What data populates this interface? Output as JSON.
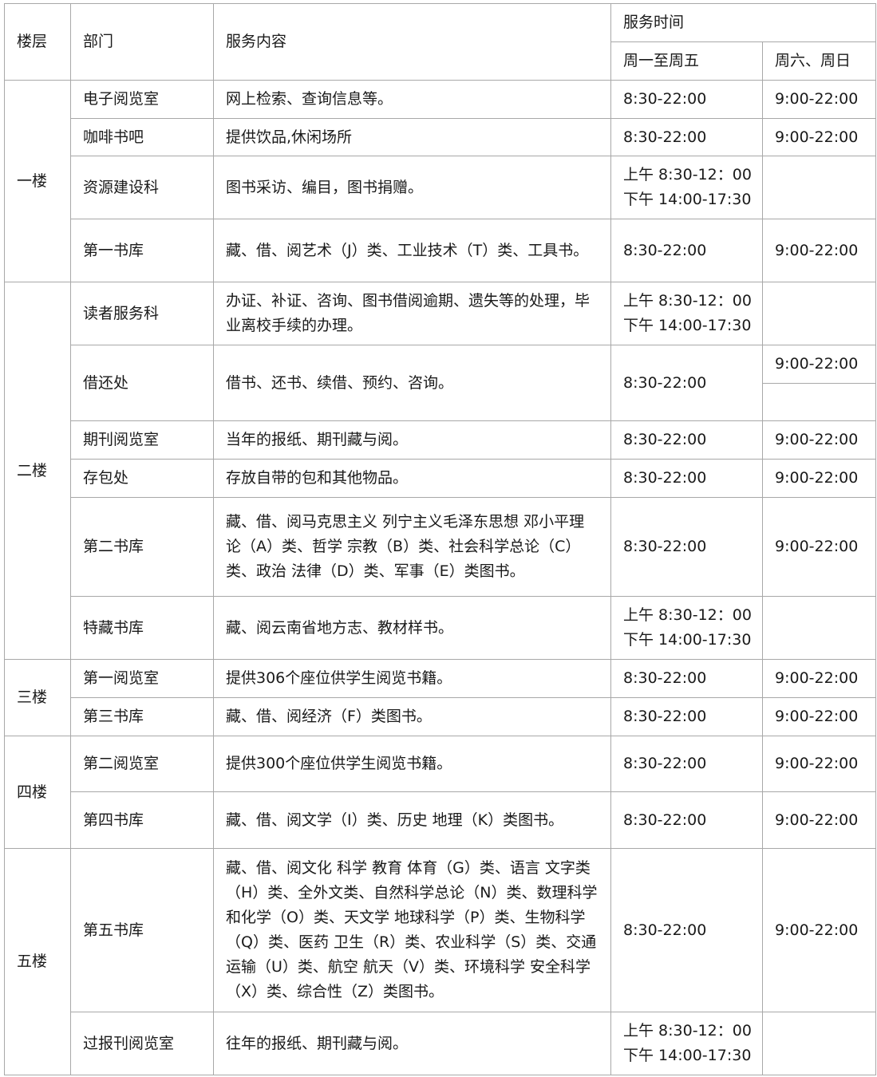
{
  "headers": {
    "floor": "楼层",
    "dept": "部门",
    "content": "服务内容",
    "service_time": "服务时间",
    "weekday": "周一至周五",
    "weekend": "周六、周日"
  },
  "floors": [
    "一楼",
    "二楼",
    "三楼",
    "四楼",
    "五楼"
  ],
  "rows": [
    {
      "dept": "电子阅览室",
      "content": "网上检索、查询信息等。",
      "weekday": "8:30-22:00",
      "weekend": "9:00-22:00"
    },
    {
      "dept": "咖啡书吧",
      "content": "提供饮品,休闲场所",
      "weekday": "8:30-22:00",
      "weekend": "9:00-22:00"
    },
    {
      "dept": "资源建设科",
      "content": "图书采访、编目，图书捐赠。",
      "weekday_am": "上午 8:30-12：00",
      "weekday_pm": "下午 14:00-17:30",
      "weekend": ""
    },
    {
      "dept": "第一书库",
      "content": "藏、借、阅艺术（J）类、工业技术（T）类、工具书。",
      "weekday": "8:30-22:00",
      "weekend": "9:00-22:00"
    },
    {
      "dept": "读者服务科",
      "content": "办证、补证、咨询、图书借阅逾期、遗失等的处理，毕业离校手续的办理。",
      "weekday_am": "上午 8:30-12：00",
      "weekday_pm": "下午 14:00-17:30",
      "weekend": ""
    },
    {
      "dept": "借还处",
      "content": "借书、还书、续借、预约、咨询。",
      "weekday": "8:30-22:00",
      "weekend": "9:00-22:00",
      "weekend_extra": ""
    },
    {
      "dept": "期刊阅览室",
      "content": "当年的报纸、期刊藏与阅。",
      "weekday": "8:30-22:00",
      "weekend": "9:00-22:00"
    },
    {
      "dept": "存包处",
      "content": "存放自带的包和其他物品。",
      "weekday": "8:30-22:00",
      "weekend": "9:00-22:00"
    },
    {
      "dept": "第二书库",
      "content": "藏、借、阅马克思主义 列宁主义毛泽东思想 邓小平理论（A）类、哲学 宗教（B）类、社会科学总论（C）类、政治 法律（D）类、军事（E）类图书。",
      "weekday": "8:30-22:00",
      "weekend": "9:00-22:00"
    },
    {
      "dept": "特藏书库",
      "content": "藏、阅云南省地方志、教材样书。",
      "weekday_am": "上午 8:30-12：00",
      "weekday_pm": "下午 14:00-17:30",
      "weekend": ""
    },
    {
      "dept": "第一阅览室",
      "content": "提供306个座位供学生阅览书籍。",
      "weekday": "8:30-22:00",
      "weekend": "9:00-22:00"
    },
    {
      "dept": "第三书库",
      "content": "藏、借、阅经济（F）类图书。",
      "weekday": "8:30-22:00",
      "weekend": "9:00-22:00"
    },
    {
      "dept": "第二阅览室",
      "content": "提供300个座位供学生阅览书籍。",
      "weekday": "8:30-22:00",
      "weekend": "9:00-22:00"
    },
    {
      "dept": "第四书库",
      "content": "藏、借、阅文学（I）类、历史 地理（K）类图书。",
      "weekday": "8:30-22:00",
      "weekend": "9:00-22:00"
    },
    {
      "dept": "第五书库",
      "content": "藏、借、阅文化 科学 教育 体育（G）类、语言 文字类（H）类、全外文类、自然科学总论（N）类、数理科学和化学（O）类、天文学 地球科学（P）类、生物科学（Q）类、医药 卫生（R）类、农业科学（S）类、交通运输（U）类、航空 航天（V）类、环境科学 安全科学（X）类、综合性（Z）类图书。",
      "weekday": "8:30-22:00",
      "weekend": "9:00-22:00"
    },
    {
      "dept": "过报刊阅览室",
      "content": "往年的报纸、期刊藏与阅。",
      "weekday_am": "上午 8:30-12：00",
      "weekday_pm": "下午 14:00-17:30",
      "weekend": ""
    }
  ]
}
